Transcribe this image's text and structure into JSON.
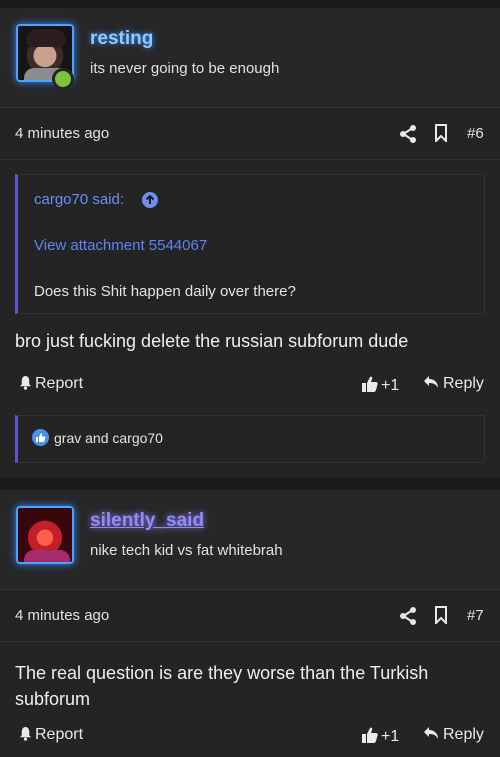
{
  "post_a": {
    "username": "resting",
    "user_title": "its never going to be enough",
    "timestamp": "4 minutes ago",
    "post_number": "#6",
    "quote": {
      "author": "cargo70 said:",
      "attachment": "View attachment 5544067",
      "text": "Does this Shit happen daily over there?"
    },
    "message": "bro just fucking delete the russian subforum dude",
    "report_label": "Report",
    "like_count": "+1",
    "reply_label": "Reply",
    "reactions": "grav and cargo70"
  },
  "post_b": {
    "username": "silently_said",
    "user_title": "nike tech kid vs fat whitebrah",
    "timestamp": "4 minutes ago",
    "post_number": "#7",
    "message": "The real question is are they worse than the Turkish subforum",
    "report_label": "Report",
    "like_count": "+1",
    "reply_label": "Reply"
  },
  "icons": {
    "share": "share-icon",
    "bookmark": "bookmark-icon",
    "quote_up": "arrow-up-circle-icon",
    "report": "bell-icon",
    "like": "thumbs-up-icon",
    "reply": "reply-icon",
    "reaction": "like-badge-icon"
  },
  "colors": {
    "background": "#1b1b1c",
    "username_blue": "#8fc8ff",
    "username_purple": "#8b8ef6",
    "link": "#5f83f2",
    "quote_border": "#5b57d6",
    "online": "#7fc23b"
  }
}
